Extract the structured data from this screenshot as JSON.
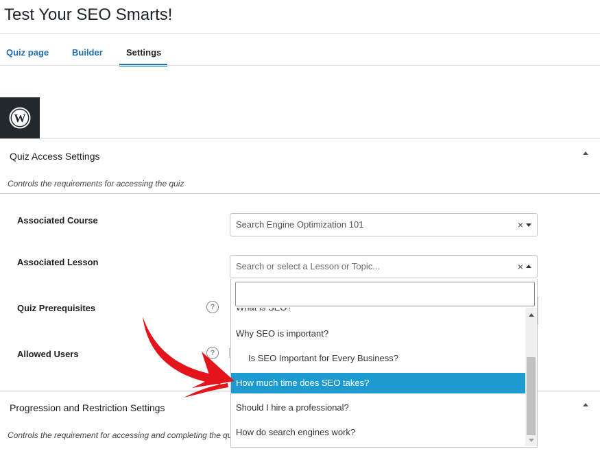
{
  "page": {
    "title": "Test Your SEO Smarts!"
  },
  "tabs": [
    {
      "label": "Quiz page"
    },
    {
      "label": "Builder"
    },
    {
      "label": "Settings",
      "active": true
    }
  ],
  "logo": {
    "icon": "wordpress-logo-icon"
  },
  "quiz_access": {
    "title": "Quiz Access Settings",
    "description": "Controls the requirements for accessing the quiz",
    "fields": {
      "associated_course": {
        "label": "Associated Course",
        "value": "Search Engine Optimization 101",
        "clear": "×"
      },
      "associated_lesson": {
        "label": "Associated Lesson",
        "placeholder": "Search or select a Lesson or Topic...",
        "clear": "×"
      },
      "quiz_prerequisites": {
        "label": "Quiz Prerequisites",
        "help": "?"
      },
      "allowed_users": {
        "label": "Allowed Users",
        "help": "?"
      }
    }
  },
  "lesson_dropdown": {
    "search_value": "",
    "partial_item": "What is SEO?",
    "items": [
      {
        "label": "Why SEO is important?",
        "child": false,
        "selected": false
      },
      {
        "label": "Is SEO Important for Every Business?",
        "child": true,
        "selected": false
      },
      {
        "label": "How much time does SEO takes?",
        "child": false,
        "selected": true
      },
      {
        "label": "Should I hire a professional?",
        "child": false,
        "selected": false
      },
      {
        "label": "How do search engines work?",
        "child": false,
        "selected": false
      }
    ]
  },
  "progression": {
    "title": "Progression and Restriction Settings",
    "description": "Controls the requirement for accessing and completing the quiz"
  },
  "colors": {
    "link_blue": "#2271b1",
    "selected_bg": "#1d9bd1",
    "annotation_arrow": "#e3151a",
    "logo_bg": "#23282d"
  }
}
